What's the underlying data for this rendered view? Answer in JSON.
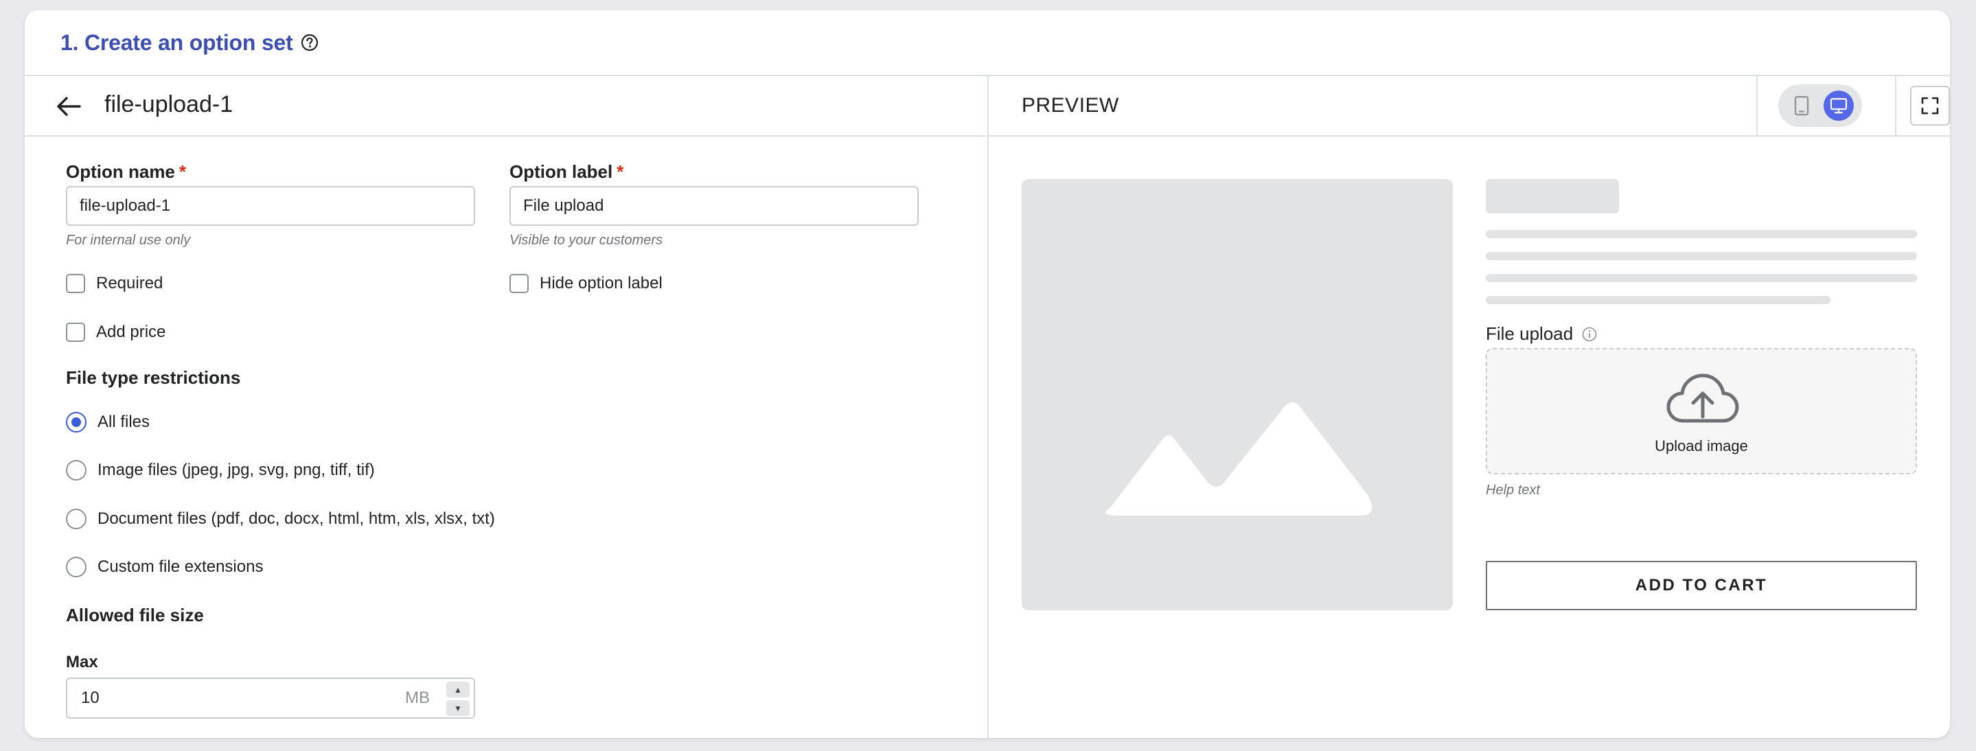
{
  "card": {
    "title": "1. Create an option set"
  },
  "editor": {
    "title": "file-upload-1",
    "option_name": {
      "label": "Option name",
      "required_mark": "*",
      "value": "file-upload-1",
      "hint": "For internal use only"
    },
    "option_label": {
      "label": "Option label",
      "required_mark": "*",
      "value": "File upload",
      "hint": "Visible to your customers"
    },
    "checkboxes": {
      "required": "Required",
      "hide_label": "Hide option label",
      "add_price": "Add price"
    },
    "file_type": {
      "title": "File type restrictions",
      "options": [
        {
          "label": "All files",
          "checked": true
        },
        {
          "label": "Image files (jpeg, jpg, svg, png, tiff, tif)",
          "checked": false
        },
        {
          "label": "Document files (pdf, doc, docx, html, htm, xls, xlsx, txt)",
          "checked": false
        },
        {
          "label": "Custom file extensions",
          "checked": false
        }
      ]
    },
    "file_size": {
      "title": "Allowed file size",
      "max_label": "Max",
      "max_value": "10",
      "unit": "MB"
    }
  },
  "preview": {
    "title": "PREVIEW",
    "upload_label": "File upload",
    "upload_text": "Upload image",
    "help_text": "Help text",
    "add_to_cart": "ADD TO CART"
  },
  "colors": {
    "accent": "#3a5ad6",
    "title": "#3c4fb1",
    "required": "#d72c0d",
    "device_active": "#5468e8"
  },
  "icons": [
    "help-circle-icon",
    "arrow-left-icon",
    "mobile-icon",
    "desktop-icon",
    "fullscreen-icon",
    "image-icon",
    "info-icon",
    "cloud-upload-icon"
  ]
}
